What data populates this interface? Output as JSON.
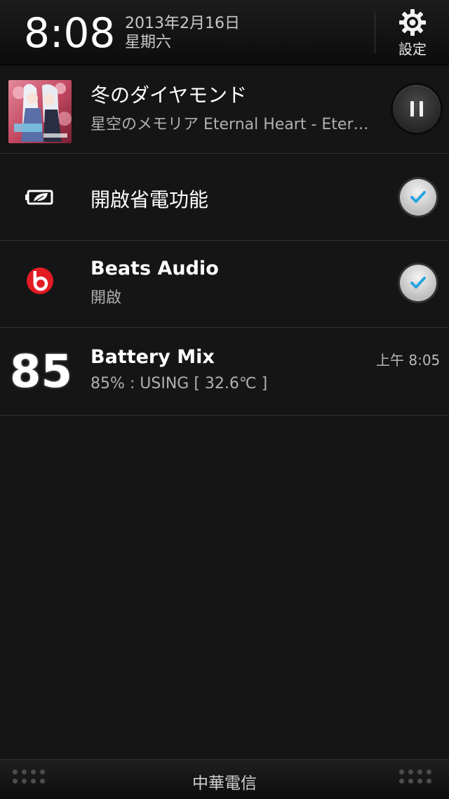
{
  "header": {
    "time": "8:08",
    "date": "2013年2月16日",
    "weekday": "星期六",
    "settings_label": "設定"
  },
  "notifications": {
    "music": {
      "title": "冬のダイヤモンド",
      "subtitle": "星空のメモリア Eternal Heart - Eter…",
      "control": "pause-icon"
    },
    "power_saver": {
      "title": "開啟省電功能",
      "checked": true,
      "icon": "battery-leaf-icon"
    },
    "beats": {
      "title": "Beats Audio",
      "subtitle": "開啟",
      "checked": true,
      "icon": "beats-logo-icon",
      "color": "#e31b23"
    },
    "battery_mix": {
      "level": "85",
      "title": "Battery Mix",
      "subtitle": "85% : USING [ 32.6℃ ]",
      "time": "上午 8:05"
    }
  },
  "footer": {
    "carrier": "中華電信"
  },
  "colors": {
    "check_mark": "#2aa3e0",
    "background": "#151515"
  }
}
